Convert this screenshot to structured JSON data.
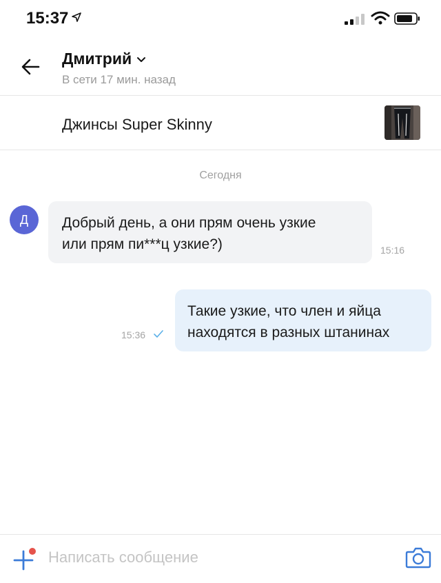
{
  "status_bar": {
    "time": "15:37"
  },
  "header": {
    "contact_name": "Дмитрий",
    "contact_status": "В сети 17 мин. назад"
  },
  "item": {
    "title": "Джинсы Super Skinny"
  },
  "chat": {
    "date_divider": "Сегодня",
    "messages": [
      {
        "direction": "incoming",
        "avatar_letter": "Д",
        "text": "Добрый день, а они прям очень узкие\nили прям пи***ц узкие?)",
        "time": "15:16"
      },
      {
        "direction": "outgoing",
        "text": "Такие узкие, что член и яйца\nнаходятся в разных штанинах",
        "time": "15:36",
        "read": true
      }
    ]
  },
  "composer": {
    "placeholder": "Написать сообщение",
    "value": ""
  },
  "colors": {
    "accent": "#3b7bd8",
    "avatar": "#5a66d6",
    "incoming_bubble": "#f2f3f5",
    "outgoing_bubble": "#e7f1fb",
    "notification_dot": "#e5534b"
  },
  "icons": [
    "location-arrow-icon",
    "signal-icon",
    "wifi-icon",
    "battery-icon",
    "back-arrow-icon",
    "chevron-down-icon",
    "read-check-icon",
    "plus-icon",
    "camera-icon"
  ]
}
